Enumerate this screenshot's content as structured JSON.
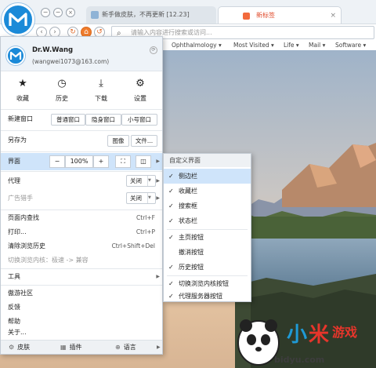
{
  "tabs": [
    {
      "title": "新手做皮肤，不再更新 [12.23]"
    },
    {
      "title": "新标签",
      "close": "×"
    }
  ],
  "address": {
    "placeholder": "请输入内容进行搜索或访问..."
  },
  "bookmarks": [
    "Ophthalmology",
    "Most Visited",
    "Life",
    "Mail",
    "Software"
  ],
  "user": {
    "name": "Dr.W.Wang",
    "email": "(wangwei1073@163.com)"
  },
  "quick": [
    {
      "label": "收藏",
      "icon": "star-icon"
    },
    {
      "label": "历史",
      "icon": "clock-icon"
    },
    {
      "label": "下载",
      "icon": "download-icon"
    },
    {
      "label": "设置",
      "icon": "gear-icon"
    }
  ],
  "new_window": {
    "label": "新建窗口",
    "normal": "普通窗口",
    "private": "隐身窗口",
    "small": "小号窗口"
  },
  "save_as": {
    "label": "另存为",
    "image": "图像",
    "file": "文件..."
  },
  "interface": {
    "label": "界面",
    "minus": "−",
    "zoom": "100%",
    "plus": "+"
  },
  "proxy": {
    "label": "代理",
    "value": "关闭"
  },
  "adblock": {
    "label": "广告猎手",
    "value": "关闭"
  },
  "items": {
    "find": {
      "label": "页面内查找",
      "shortcut": "Ctrl+F"
    },
    "print": {
      "label": "打印...",
      "shortcut": "Ctrl+P"
    },
    "clear": {
      "label": "清除浏览历史",
      "shortcut": "Ctrl+Shift+Del"
    },
    "engine": {
      "label": "切换浏览内核：极速 -> 兼容"
    },
    "tools": {
      "label": "工具"
    },
    "community": {
      "label": "傲游社区"
    },
    "feedback": {
      "label": "反馈"
    },
    "help": {
      "label": "帮助"
    },
    "about": {
      "label": "关于..."
    }
  },
  "footer": {
    "skin": "皮肤",
    "plugin": "插件",
    "lang": "语言"
  },
  "submenu": {
    "title": "自定义界面",
    "items": [
      {
        "label": "侧边栏",
        "checked": true
      },
      {
        "label": "收藏栏",
        "checked": true
      },
      {
        "label": "搜索框",
        "checked": true
      },
      {
        "label": "状态栏",
        "checked": true
      },
      {
        "label": "主页按钮",
        "checked": true
      },
      {
        "label": "撤消按钮",
        "checked": false
      },
      {
        "label": "历史按钮",
        "checked": true
      },
      {
        "label": "切换浏览内核按钮",
        "checked": true
      },
      {
        "label": "代理服务器按钮",
        "checked": true
      }
    ]
  },
  "watermark": {
    "text": "bidyu.com"
  },
  "colors": {
    "brand": "#1b8ad8",
    "highlight": "#cfe4fa",
    "home": "#f07c2c"
  }
}
